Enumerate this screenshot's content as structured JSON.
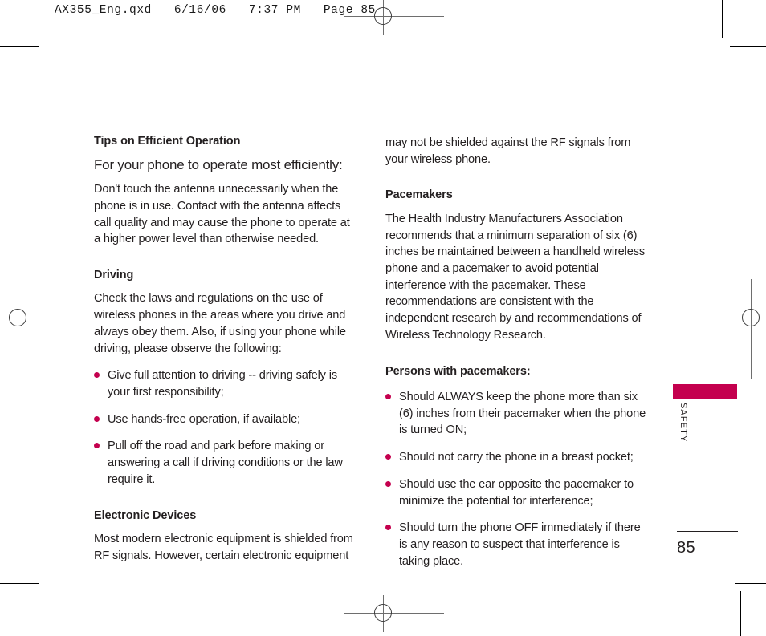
{
  "prepress": {
    "slug": "AX355_Eng.qxd   6/16/06   7:37 PM   Page 85"
  },
  "document": {
    "section_tab_label": "SAFETY",
    "page_number": "85",
    "accent_color": "#c4004e",
    "text_color": "#231f20"
  },
  "left_column": {
    "heading_tips": "Tips on Efficient Operation",
    "lead_tips": "For your phone to operate most efficiently:",
    "body_tips": "Don't touch the antenna unnecessarily when the phone is in use. Contact with the antenna affects call quality and may cause the phone to operate at a higher power level than otherwise needed.",
    "heading_driving": "Driving",
    "body_driving": "Check the laws and regulations on the use of wireless phones in the areas where you drive and always obey them. Also, if using your phone while driving, please observe the following:",
    "driving_bullets": [
      "Give full attention to driving -- driving safely is your first responsibility;",
      "Use hands-free operation, if available;",
      "Pull off the road and park before making or answering a call if driving conditions or the law require it."
    ],
    "heading_electronic": "Electronic Devices",
    "body_electronic": "Most modern electronic equipment is shielded from RF signals. However, certain electronic equipment"
  },
  "right_column": {
    "body_continued": "may not be shielded against the RF signals from your wireless phone.",
    "heading_pacemakers": "Pacemakers",
    "body_pacemakers": "The Health Industry Manufacturers Association recommends that a minimum separation of six (6) inches be maintained between a handheld wireless phone and a pacemaker to avoid potential interference with the pacemaker. These recommendations are consistent with the independent research by and recommendations of Wireless Technology Research.",
    "heading_persons": "Persons with pacemakers:",
    "persons_bullets": [
      "Should ALWAYS keep the phone more than six (6) inches from their pacemaker when the phone is turned ON;",
      "Should not carry the phone in a breast pocket;",
      "Should use the ear opposite the pacemaker to minimize the potential for interference;",
      "Should turn the phone OFF immediately if there is any reason to suspect that interference is taking place."
    ]
  }
}
